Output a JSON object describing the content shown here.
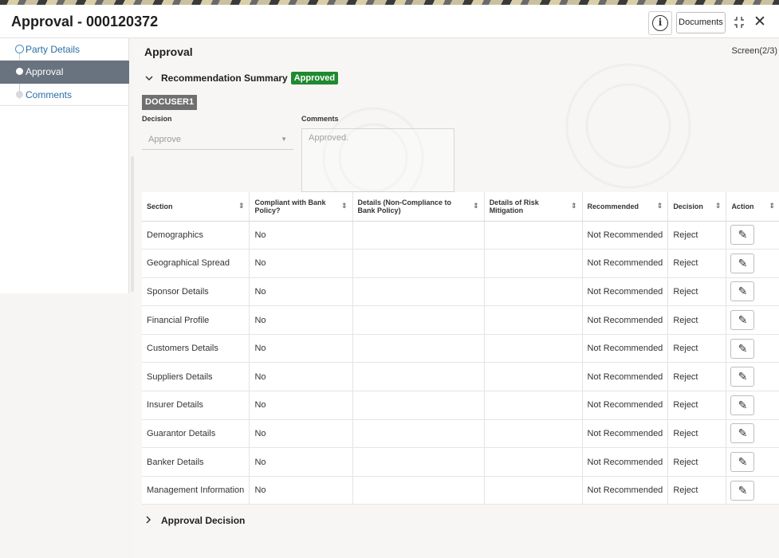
{
  "window": {
    "title": "Approval - 000120372",
    "documents_label": "Documents",
    "info_glyph": "i",
    "collapse_glyph": "⌟⌞",
    "close_glyph": "✕"
  },
  "sidebar": {
    "items": [
      {
        "label": "Party Details",
        "state": "completed"
      },
      {
        "label": "Approval",
        "state": "active"
      },
      {
        "label": "Comments",
        "state": "pending"
      }
    ]
  },
  "main": {
    "heading": "Approval",
    "screen_counter": "Screen(2/3)",
    "recommendation": {
      "title": "Recommendation Summary",
      "status": "Approved",
      "user": "DOCUSER1",
      "decision_label": "Decision",
      "decision_value": "Approve",
      "comments_label": "Comments",
      "comments_value": "Approved."
    },
    "table": {
      "headers": [
        "Section",
        "Compliant with Bank Policy?",
        "Details (Non-Compliance to Bank Policy)",
        "Details of Risk Mitigation",
        "Recommended",
        "Decision",
        "Action"
      ],
      "rows": [
        {
          "section": "Demographics",
          "compliant": "No",
          "details_nc": "",
          "risk": "",
          "recommended": "Not Recommended",
          "decision": "Reject"
        },
        {
          "section": "Geographical Spread",
          "compliant": "No",
          "details_nc": "",
          "risk": "",
          "recommended": "Not Recommended",
          "decision": "Reject"
        },
        {
          "section": "Sponsor Details",
          "compliant": "No",
          "details_nc": "",
          "risk": "",
          "recommended": "Not Recommended",
          "decision": "Reject"
        },
        {
          "section": "Financial Profile",
          "compliant": "No",
          "details_nc": "",
          "risk": "",
          "recommended": "Not Recommended",
          "decision": "Reject"
        },
        {
          "section": "Customers Details",
          "compliant": "No",
          "details_nc": "",
          "risk": "",
          "recommended": "Not Recommended",
          "decision": "Reject"
        },
        {
          "section": "Suppliers Details",
          "compliant": "No",
          "details_nc": "",
          "risk": "",
          "recommended": "Not Recommended",
          "decision": "Reject"
        },
        {
          "section": "Insurer Details",
          "compliant": "No",
          "details_nc": "",
          "risk": "",
          "recommended": "Not Recommended",
          "decision": "Reject"
        },
        {
          "section": "Guarantor Details",
          "compliant": "No",
          "details_nc": "",
          "risk": "",
          "recommended": "Not Recommended",
          "decision": "Reject"
        },
        {
          "section": "Banker Details",
          "compliant": "No",
          "details_nc": "",
          "risk": "",
          "recommended": "Not Recommended",
          "decision": "Reject"
        },
        {
          "section": "Management Information",
          "compliant": "No",
          "details_nc": "",
          "risk": "",
          "recommended": "Not Recommended",
          "decision": "Reject"
        }
      ]
    },
    "approval_decision_title": "Approval Decision"
  },
  "colors": {
    "approved_badge": "#1f8a30",
    "sidebar_active": "#69727f",
    "link_blue": "#2a6ea6",
    "user_badge": "#6f6f6f"
  },
  "icons": {
    "info": "info-icon",
    "collapse": "collapse-icon",
    "close": "close-icon",
    "sort": "sort-icon",
    "edit": "pencil-icon",
    "chevron_down": "chevron-down-icon",
    "chevron_right": "chevron-right-icon"
  }
}
